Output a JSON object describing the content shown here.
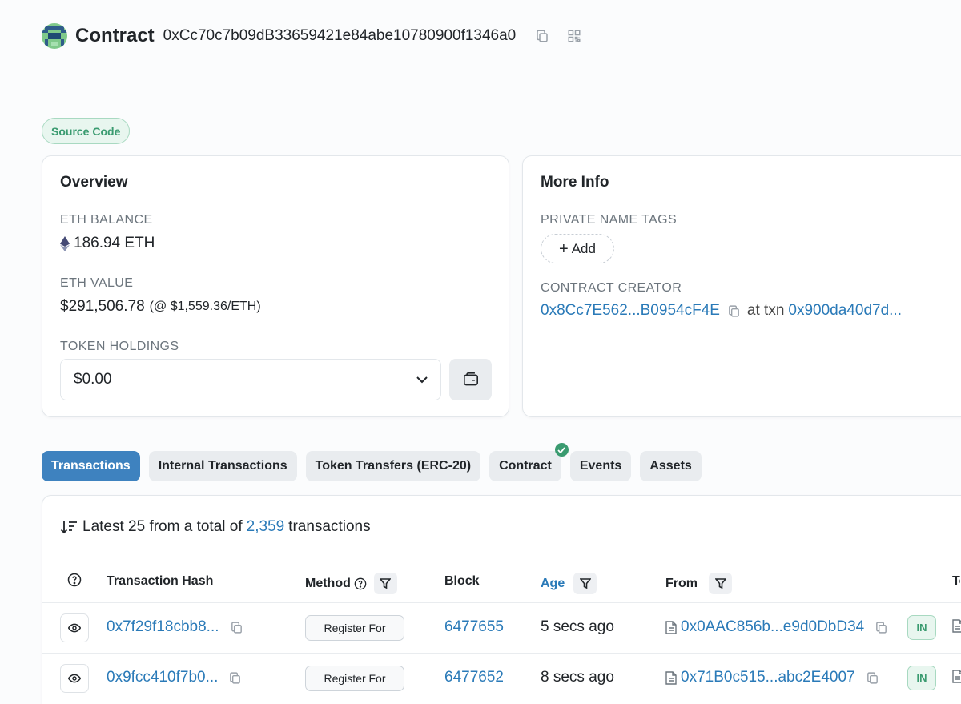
{
  "header": {
    "title": "Contract",
    "address": "0xCc70c7b09dB33659421e84abe10780900f1346a0"
  },
  "badge": {
    "source_code": "Source Code"
  },
  "overview": {
    "title": "Overview",
    "eth_balance_label": "ETH BALANCE",
    "eth_balance": "186.94 ETH",
    "eth_value_label": "ETH VALUE",
    "eth_value": "$291,506.78",
    "eth_price": "(@ $1,559.36/ETH)",
    "token_holdings_label": "TOKEN HOLDINGS",
    "token_holdings_value": "$0.00"
  },
  "more_info": {
    "title": "More Info",
    "private_tags_label": "PRIVATE NAME TAGS",
    "add_label": "Add",
    "creator_label": "CONTRACT CREATOR",
    "creator_address": "0x8Cc7E562...B0954cF4E",
    "at_txn": "at txn",
    "creation_txn": "0x900da40d7d..."
  },
  "tabs": [
    {
      "label": "Transactions",
      "active": true
    },
    {
      "label": "Internal Transactions"
    },
    {
      "label": "Token Transfers (ERC-20)"
    },
    {
      "label": "Contract",
      "verified": true
    },
    {
      "label": "Events"
    },
    {
      "label": "Assets"
    }
  ],
  "transactions": {
    "summary_prefix": "Latest 25 from a total of",
    "total": "2,359",
    "summary_suffix": "transactions",
    "columns": {
      "hash": "Transaction Hash",
      "method": "Method",
      "block": "Block",
      "age": "Age",
      "from": "From",
      "to": "To"
    },
    "rows": [
      {
        "hash": "0x7f29f18cbb8...",
        "method": "Register For",
        "block": "6477655",
        "age": "5 secs ago",
        "from": "0x0AAC856b...e9d0DbD34",
        "direction": "IN"
      },
      {
        "hash": "0x9fcc410f7b0...",
        "method": "Register For",
        "block": "6477652",
        "age": "8 secs ago",
        "from": "0x71B0c515...abc2E4007",
        "direction": "IN"
      }
    ]
  },
  "colors": {
    "accent": "#3e82bf",
    "link": "#2a7ab8",
    "success": "#3a9b70"
  }
}
